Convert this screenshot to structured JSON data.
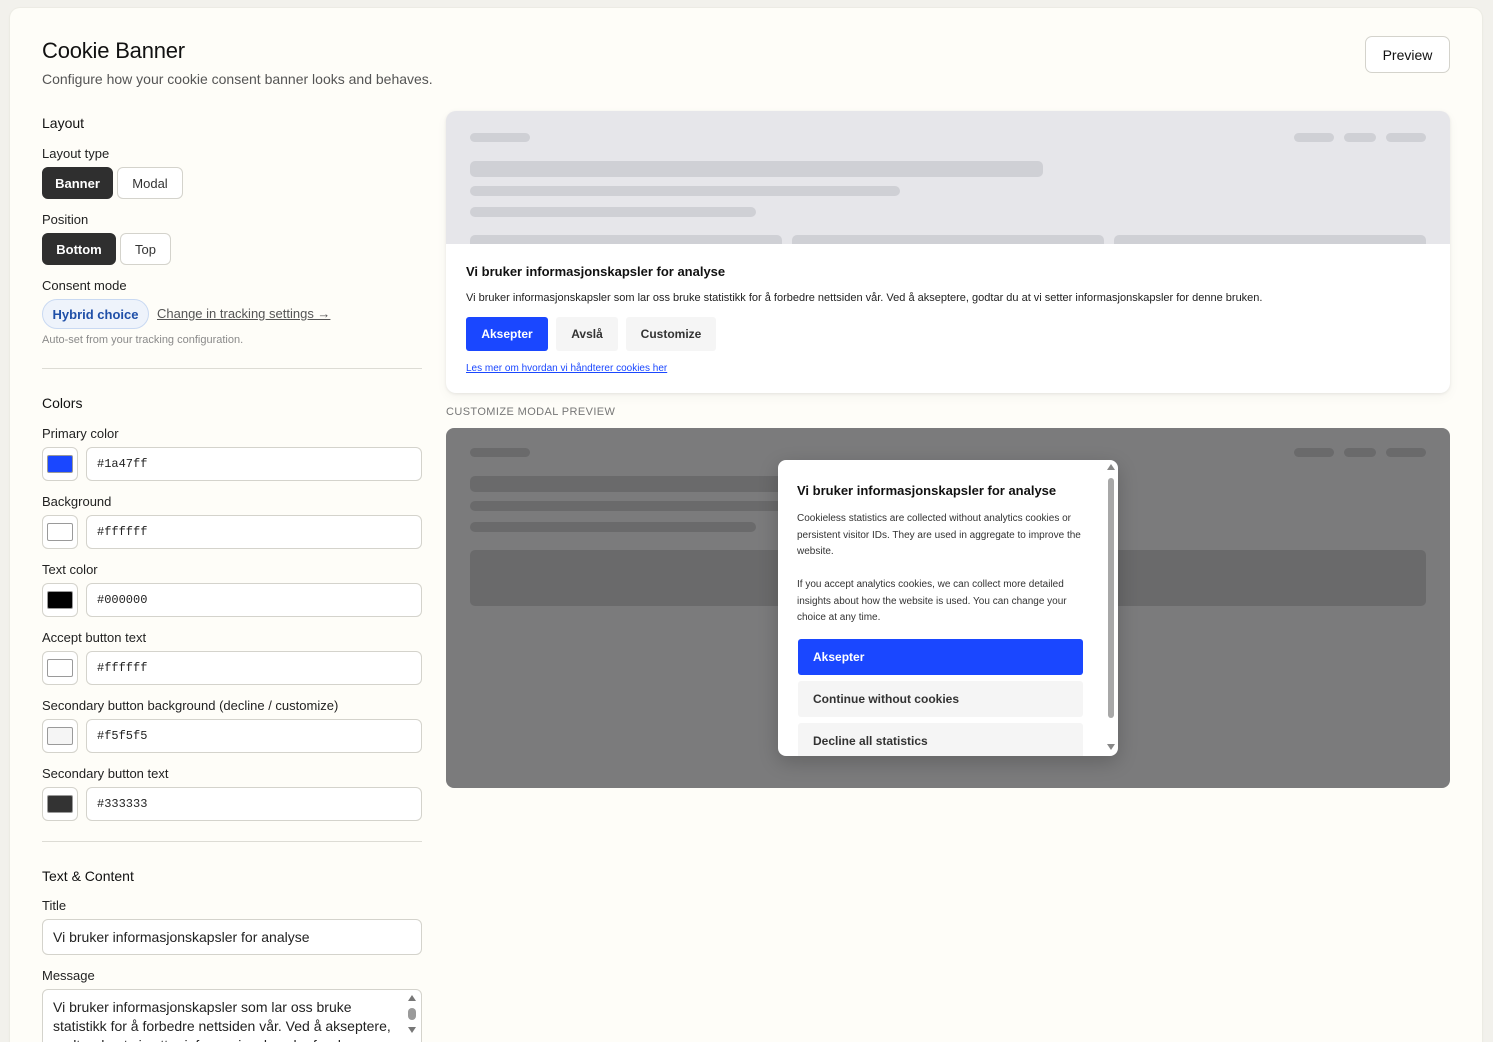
{
  "header": {
    "title": "Cookie Banner",
    "subtitle": "Configure how your cookie consent banner looks and behaves.",
    "preview_label": "Preview"
  },
  "layout": {
    "heading": "Layout",
    "layout_type_label": "Layout type",
    "layout_options": [
      "Banner",
      "Modal"
    ],
    "layout_selected": "Banner",
    "position_label": "Position",
    "position_options": [
      "Bottom",
      "Top"
    ],
    "position_selected": "Bottom",
    "consent_label": "Consent mode",
    "consent_value": "Hybrid choice",
    "consent_link": "Change in tracking settings →",
    "consent_hint": "Auto-set from your tracking configuration."
  },
  "colors": {
    "heading": "Colors",
    "fields": [
      {
        "label": "Primary color",
        "value": "#1a47ff",
        "swatch": "#1a47ff"
      },
      {
        "label": "Background",
        "value": "#ffffff",
        "swatch": "#ffffff"
      },
      {
        "label": "Text color",
        "value": "#000000",
        "swatch": "#000000"
      },
      {
        "label": "Accept button text",
        "value": "#ffffff",
        "swatch": "#ffffff"
      },
      {
        "label": "Secondary button background (decline / customize)",
        "value": "#f5f5f5",
        "swatch": "#f5f5f5"
      },
      {
        "label": "Secondary button text",
        "value": "#333333",
        "swatch": "#333333"
      }
    ]
  },
  "content": {
    "heading": "Text & Content",
    "title_label": "Title",
    "title_value": "Vi bruker informasjonskapsler for analyse",
    "message_label": "Message",
    "message_value": "Vi bruker informasjonskapsler som lar oss bruke statistikk for å forbedre nettsiden vår. Ved å akseptere, godtar du at vi setter informasjonskapsler for denne bruken."
  },
  "banner_preview": {
    "title": "Vi bruker informasjonskapsler for analyse",
    "message": "Vi bruker informasjonskapsler som lar oss bruke statistikk for å forbedre nettsiden vår. Ved å akseptere, godtar du at vi setter informasjonskapsler for denne bruken.",
    "accept": "Aksepter",
    "decline": "Avslå",
    "customize": "Customize",
    "link": "Les mer om hvordan vi håndterer cookies her"
  },
  "modal_preview": {
    "section_label": "CUSTOMIZE MODAL PREVIEW",
    "title": "Vi bruker informasjonskapsler for analyse",
    "paragraph1": "Cookieless statistics are collected without analytics cookies or persistent visitor IDs. They are used in aggregate to improve the website.",
    "paragraph2": "If you accept analytics cookies, we can collect more detailed insights about how the website is used. You can change your choice at any time.",
    "accept": "Aksepter",
    "continue": "Continue without cookies",
    "decline_all": "Decline all statistics"
  }
}
